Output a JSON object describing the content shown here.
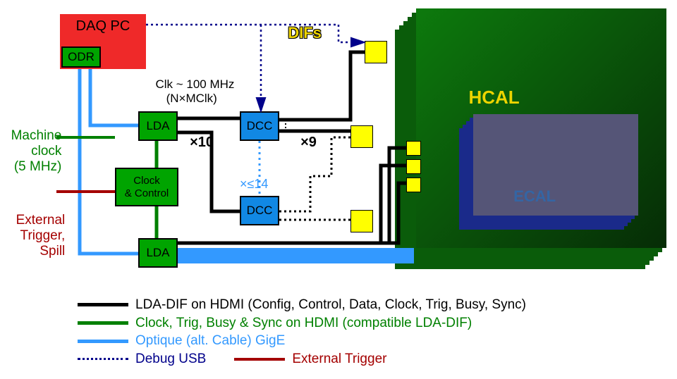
{
  "blocks": {
    "daq_pc": "DAQ PC",
    "odr": "ODR",
    "lda1": "LDA",
    "lda2": "LDA",
    "clock_control": "Clock\n& Control",
    "dcc1": "DCC",
    "dcc2": "DCC"
  },
  "annotations": {
    "difs": "DIFs",
    "clk_rate": "Clk ~ 100 MHz\n(N×MClk)",
    "x10": "×10",
    "x9": "×9",
    "xle14": "×≤14",
    "machine_clock": "Machine\nclock\n(5 MHz)",
    "external_trigger_spill": "External\nTrigger,\nSpill",
    "hcal": "HCAL",
    "ecal": "ECAL"
  },
  "legend": {
    "lda_dif": "LDA-DIF on HDMI (Config, Control, Data, Clock, Trig, Busy, Sync)",
    "clock_hdmi": "Clock, Trig, Busy & Sync on HDMI (compatible LDA-DIF)",
    "gige": "Optique (alt. Cable) GigE",
    "debug_usb": "Debug USB",
    "ext_trigger": "External Trigger"
  },
  "colors": {
    "red": "#ef2929",
    "green_box": "#00a400",
    "green_text": "#008000",
    "blue_box": "#3465a4",
    "blue_fill": "#1188e4",
    "blue_light": "#3399ff",
    "yellow": "#ffff00",
    "yellow_text": "#edd400",
    "navy": "#00008b",
    "darkred": "#a40000",
    "hcal_green": "#0a5c0a",
    "ecal_slate": "#555577"
  }
}
